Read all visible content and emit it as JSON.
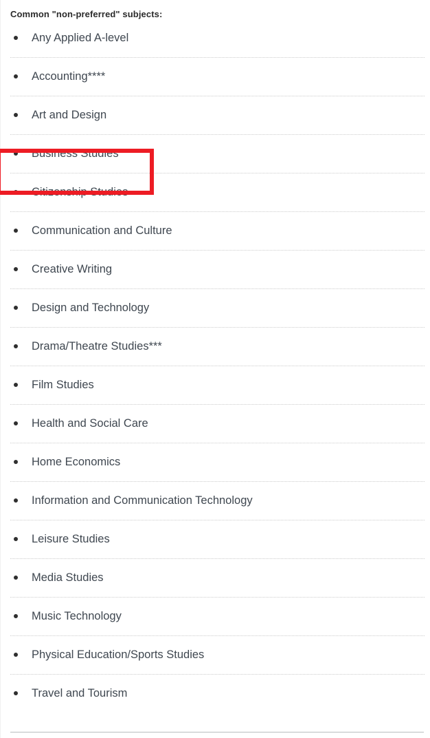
{
  "page": {
    "heading": "Common \"non-preferred\" subjects:",
    "background_color": "#ffffff",
    "text_color": "#3f4750",
    "separator_color": "#cccccc",
    "bottom_rule_color": "#b9bcbe"
  },
  "annotation": {
    "type": "highlight-rectangle",
    "color": "#ed1c24",
    "target_item": "Business Studies",
    "stroke_width_px": 6
  },
  "list": {
    "items": [
      {
        "label": "Any Applied A-level"
      },
      {
        "label": "Accounting****"
      },
      {
        "label": "Art and Design"
      },
      {
        "label": "Business Studies"
      },
      {
        "label": "Citizenship Studies"
      },
      {
        "label": "Communication and Culture"
      },
      {
        "label": "Creative Writing"
      },
      {
        "label": "Design and Technology"
      },
      {
        "label": "Drama/Theatre Studies***"
      },
      {
        "label": "Film Studies"
      },
      {
        "label": "Health and Social Care"
      },
      {
        "label": "Home Economics"
      },
      {
        "label": "Information and Communication Technology"
      },
      {
        "label": "Leisure Studies"
      },
      {
        "label": "Media Studies"
      },
      {
        "label": "Music Technology"
      },
      {
        "label": "Physical Education/Sports Studies"
      },
      {
        "label": "Travel and Tourism"
      }
    ]
  }
}
